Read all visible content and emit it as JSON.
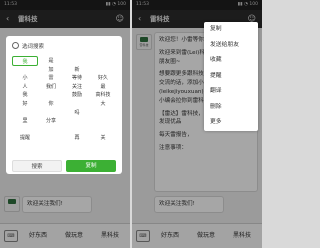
{
  "left": {
    "status": {
      "time": "11:53",
      "signal": "▮▮ ◔ 100"
    },
    "title": "雷科技",
    "bubbles": [
      {
        "text": "欢迎关注我们!"
      }
    ],
    "menu": [
      "好东西",
      "做玩意",
      "黑科技"
    ],
    "dialog": {
      "title": "选词搜索",
      "words": [
        "我",
        "是",
        "",
        "",
        "",
        "加",
        "新",
        "",
        "小",
        "雷",
        "等待",
        "好久",
        "人",
        "我们",
        "关注",
        "最",
        "我",
        "",
        "鼓励",
        "高科技",
        "好",
        "你",
        "",
        "大",
        "",
        "",
        "吗",
        "",
        "里",
        "分享",
        "",
        "",
        "",
        "",
        "",
        "",
        "提醒",
        "",
        "再",
        "关",
        "",
        "",
        "",
        "",
        "",
        "",
        "",
        ""
      ],
      "selected_index": 0,
      "cancel": "搜索",
      "confirm": "复制"
    }
  },
  "right": {
    "status": {
      "time": "11:53",
      "signal": "▮▮ ◔ 100"
    },
    "title": "雷科技",
    "avatar_label": "雷科技",
    "bubbles": [
      {
        "lines": [
          "欢迎您！小雷等你好久了~"
        ]
      },
      {
        "lines": [
          "欢迎来到雷(Lei)科技的",
          "朋友圈~"
        ]
      },
      {
        "lines": [
          "想要跟更多跟科技爱好者",
          "交流的话，添加小编微信",
          "(leikejiyouxuan)，回复“加群”，",
          "小编会拉你到雷科技交流群。"
        ]
      },
      {
        "lines": [
          "【雷达】雷科技，第一时间",
          "发现优品"
        ]
      },
      {
        "lines": [
          "每天雷报告，"
        ]
      },
      {
        "lines": [
          "注意事项："
        ]
      },
      {
        "lines": [
          "欢迎关注我们!"
        ]
      }
    ],
    "context_menu": [
      "复制",
      "发送给朋友",
      "收藏",
      "提醒",
      "翻译",
      "删除",
      "更多"
    ],
    "menu": [
      "好东西",
      "做玩意",
      "黑科技"
    ]
  }
}
